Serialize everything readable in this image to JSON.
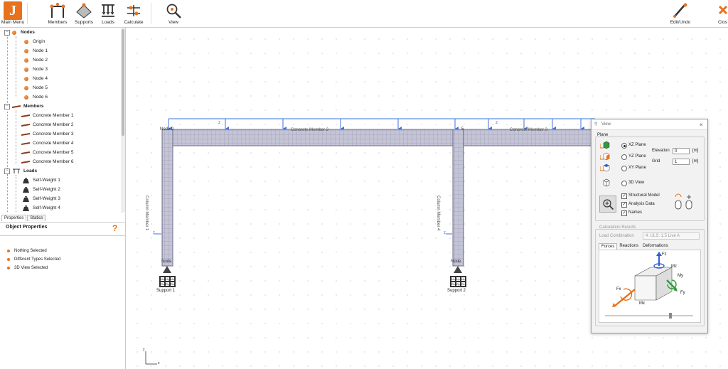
{
  "toolbar": {
    "main_menu": "Main Menu",
    "members": "Members",
    "supports": "Supports",
    "loads": "Loads",
    "calculate": "Calculate",
    "view": "View",
    "edit_undo": "Edit/Undo",
    "close": "Clos"
  },
  "tree": {
    "nodes_label": "Nodes",
    "nodes": [
      "Origin",
      "Node 1",
      "Node 2",
      "Node 3",
      "Node 4",
      "Node 5",
      "Node 6"
    ],
    "members_label": "Members",
    "members": [
      "Concrete Member 1",
      "Concrete Member 2",
      "Concrete Member 3",
      "Concrete Member 4",
      "Concrete Member 5",
      "Concrete Member 6"
    ],
    "loads_label": "Loads",
    "loads": [
      "Self-Weight 1",
      "Self-Weight 2",
      "Self-Weight 3",
      "Self-Weight 4"
    ]
  },
  "properties": {
    "tab_properties": "Properties",
    "tab_statics": "Statics",
    "title": "Object Properties",
    "items": [
      "Nothing Selected",
      "Different Types Selected",
      "3D View Selected"
    ]
  },
  "canvas": {
    "node_label_left": "Node 2",
    "node_label_mid": "5",
    "beam_label_1": "Concrete Member 2",
    "beam_label_2": "Concrete Member 3",
    "column_label_1": "Column Member 1",
    "column_label_2": "Column Member 4",
    "load_z": "z",
    "support_1": "Support 1",
    "support_2": "Support 2",
    "bottom_node_1": "Node",
    "bottom_node_2": "Node",
    "support_cells": [
      "Ux",
      "Uy",
      "Uz",
      "Rx",
      "Ry",
      "Rz"
    ],
    "axis_z": "z",
    "axis_x": "x"
  },
  "view_dialog": {
    "title": "View",
    "plane_label": "Plane",
    "xz_plane": "XZ Plane",
    "yz_plane": "YZ Plane",
    "xy_plane": "XY Plane",
    "view_3d": "3D View",
    "elevation_label": "Elevation",
    "elevation_value": "0",
    "grid_label": "Grid",
    "grid_value": "1",
    "unit": "[m]",
    "structural_model": "Structural Model",
    "analysis_data": "Analysis Data",
    "names": "Names",
    "calc_results": "Calculation Results",
    "load_combination_label": "Load Combination",
    "load_combination_value": "4. ULS: 1.5 Live A",
    "tab_forces": "Forces",
    "tab_reactions": "Reactions",
    "tab_deformations": "Deformations",
    "force_labels": {
      "fz": "Fz",
      "mz": "Mz",
      "my": "My",
      "fx": "Fx",
      "mx": "Mx",
      "fy": "Fy"
    },
    "colors": {
      "accent": "#e8721c",
      "green": "#2e9b3a",
      "blue": "#2f5fd1",
      "load_blue": "#3b6fe0"
    }
  }
}
